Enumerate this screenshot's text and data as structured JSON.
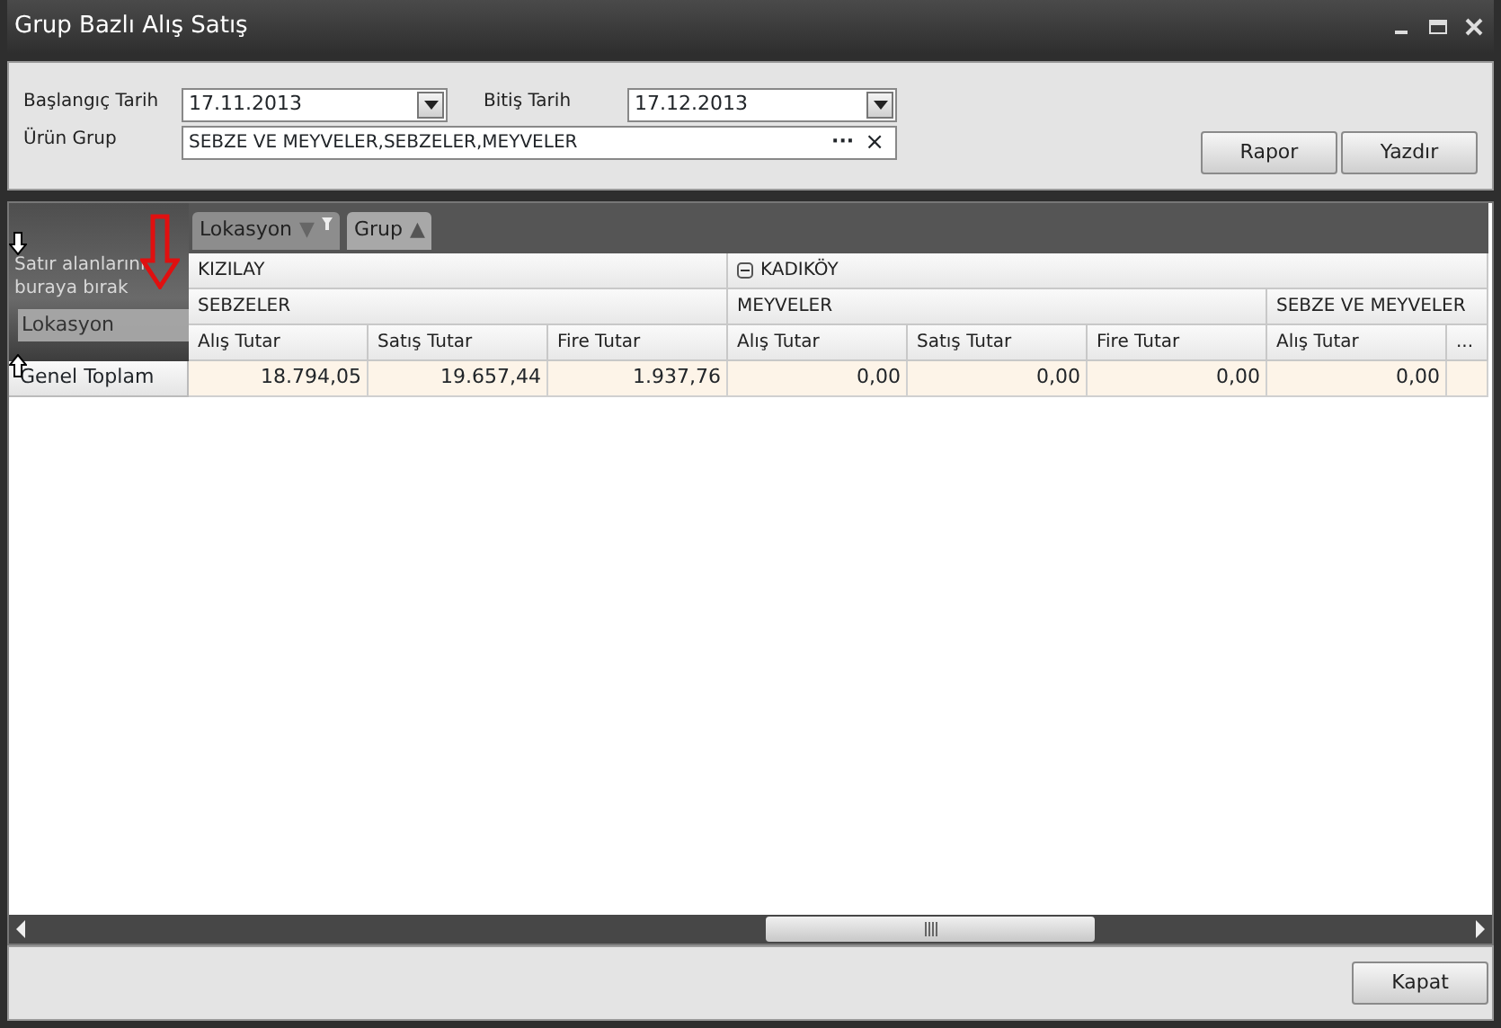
{
  "window": {
    "title": "Grup Bazlı Alış Satış"
  },
  "filters": {
    "start_date": {
      "label": "Başlangıç Tarih",
      "value": "17.11.2013"
    },
    "end_date": {
      "label": "Bitiş Tarih",
      "value": "17.12.2013"
    },
    "product_group": {
      "label": "Ürün Grup",
      "value": "SEBZE VE MEYVELER,SEBZELER,MEYVELER",
      "browse_glyph": "···",
      "clear_glyph": "×"
    }
  },
  "actions": [
    "Rapor",
    "Yazdır"
  ],
  "pivot": {
    "column_fields": [
      {
        "label": "Lokasyon",
        "glyph": "▼",
        "filtered": true
      },
      {
        "label": "Grup",
        "glyph": "▲",
        "filtered": false
      }
    ],
    "row_area_hint": "Satır alanlarını buraya bırak",
    "row_fields": [
      {
        "label": "Lokasyon"
      }
    ],
    "locations": [
      {
        "label": "KIZILAY",
        "groups": [
          {
            "label": "SEBZELER",
            "measures": [
              "Alış Tutar",
              "Satış Tutar",
              "Fire Tutar"
            ]
          }
        ]
      },
      {
        "label": "KADIKÖY",
        "expanded": true,
        "groups": [
          {
            "label": "MEYVELER",
            "measures": [
              "Alış Tutar",
              "Satış Tutar",
              "Fire Tutar"
            ]
          },
          {
            "label": "SEBZE VE MEYVELER",
            "measures": [
              "Alış Tutar"
            ]
          }
        ]
      }
    ],
    "more_glyph": "...",
    "rows": [
      {
        "label": "Genel Toplam",
        "values": [
          "18.794,05",
          "19.657,44",
          "1.937,76",
          "0,00",
          "0,00",
          "0,00",
          "0,00"
        ]
      }
    ]
  },
  "footer_buttons": [
    "Kapat"
  ]
}
